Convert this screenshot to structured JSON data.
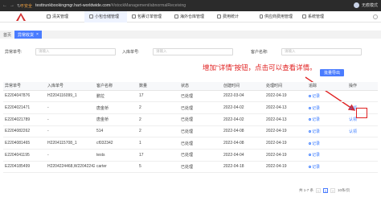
{
  "browser": {
    "back_icon": "←",
    "forward_icon": "→",
    "refresh_icon": "↻",
    "security_label": "不安全",
    "url_host": "testtrunkbookingmgr.hart-worldwide.com",
    "url_path": "/#/stockManagement/abnormalReceiving",
    "profile_name": "无痕模式"
  },
  "nav": {
    "items": [
      {
        "label": "清关管理"
      },
      {
        "label": "小包仓储管理"
      },
      {
        "label": "包裹订单管理"
      },
      {
        "label": "海外仓库管理"
      },
      {
        "label": "费用统计"
      },
      {
        "label": "供应商费用管理"
      },
      {
        "label": "系统管理"
      }
    ]
  },
  "tabs": [
    {
      "label": "首页"
    },
    {
      "label": "异常收货"
    }
  ],
  "filters": [
    {
      "label": "异常单号:",
      "placeholder": "请输入"
    },
    {
      "label": "入库单号:",
      "placeholder": "请输入"
    },
    {
      "label": "客户名称:",
      "placeholder": "请输入"
    }
  ],
  "export_label": "批量导出",
  "annotation": "增加“详情”按钮，点击可以查看详情。",
  "table": {
    "headers": [
      "异常单号",
      "入库单号",
      "客户名称",
      "数量",
      "状态",
      "创建时间",
      "处理时间",
      "追踪",
      "操作"
    ],
    "rows": [
      {
        "no": "E2204047876",
        "inbound": "H2204116099_1",
        "customer": "鹏拉",
        "qty": "17",
        "status": "已处理",
        "created": "2022-03-04",
        "handled": "2022-04-19",
        "track": "记录",
        "op": ""
      },
      {
        "no": "E2204021471",
        "inbound": "-",
        "customer": "唐金桥",
        "qty": "2",
        "status": "已处理",
        "created": "2022-04-02",
        "handled": "2022-04-13",
        "track": "记录",
        "op": "认领"
      },
      {
        "no": "E2204021789",
        "inbound": "-",
        "customer": "唐金桥",
        "qty": "2",
        "status": "已处理",
        "created": "2022-04-02",
        "handled": "2022-04-13",
        "track": "记录",
        "op": "认领"
      },
      {
        "no": "E2204082262",
        "inbound": "-",
        "customer": "514",
        "qty": "2",
        "status": "已处理",
        "created": "2022-04-08",
        "handled": "2022-04-19",
        "track": "记录",
        "op": "认领"
      },
      {
        "no": "E2204081465",
        "inbound": "H2204115708_1",
        "customer": "cf032342",
        "qty": "1",
        "status": "已处理",
        "created": "2022-04-08",
        "handled": "2022-04-19",
        "track": "记录",
        "op": ""
      },
      {
        "no": "E2204041195",
        "inbound": "-",
        "customer": "tests",
        "qty": "17",
        "status": "已处理",
        "created": "2022-04-04",
        "handled": "2022-04-19",
        "track": "记录",
        "op": ""
      },
      {
        "no": "E2204185499",
        "inbound": "H2204224468,W2204224201",
        "customer": "carter",
        "qty": "5",
        "status": "已处理",
        "created": "2022-04-18",
        "handled": "2022-04-19",
        "track": "记录",
        "op": ""
      }
    ]
  },
  "pager": {
    "total": "共 1-7 条",
    "per_page": "10条/页",
    "current": "1",
    "prev_icon": "‹",
    "next_icon": "›"
  },
  "colors": {
    "accent": "#4a7cff",
    "annotation": "#e02020"
  }
}
